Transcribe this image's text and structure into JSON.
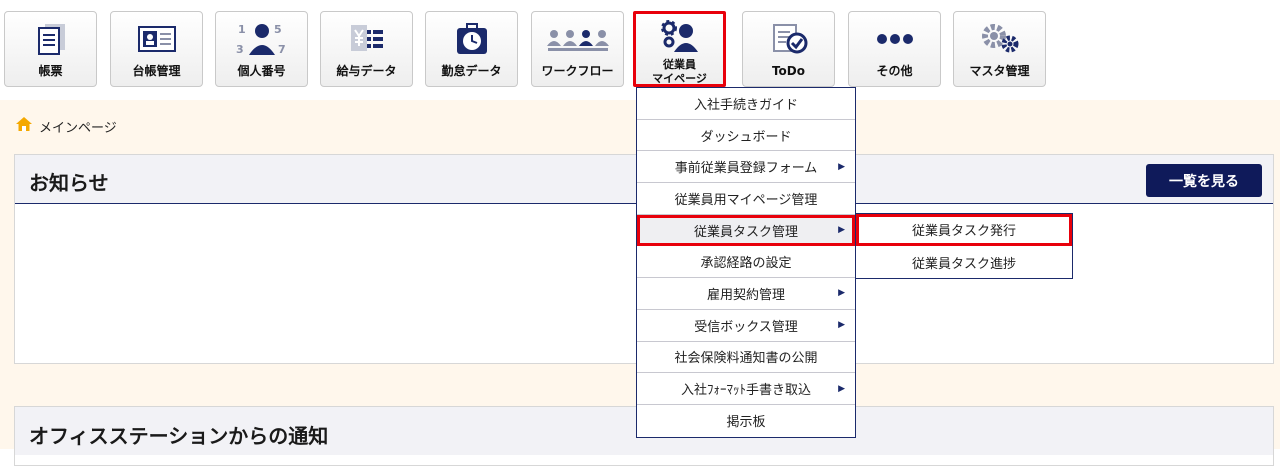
{
  "toolbar": {
    "buttons": [
      {
        "label": "帳票"
      },
      {
        "label": "台帳管理"
      },
      {
        "label": "個人番号"
      },
      {
        "label": "給与データ"
      },
      {
        "label": "勤怠データ"
      },
      {
        "label": "ワークフロー"
      },
      {
        "label_line1": "従業員",
        "label_line2": "マイページ"
      },
      {
        "label": "ToDo"
      },
      {
        "label": "その他"
      },
      {
        "label": "マスタ管理"
      }
    ]
  },
  "breadcrumb": {
    "label": "メインページ"
  },
  "notices": {
    "title": "お知らせ",
    "view_all_label": "一覧を見る"
  },
  "office_station": {
    "title": "オフィスステーションからの通知"
  },
  "menu": {
    "items": [
      {
        "label": "入社手続きガイド"
      },
      {
        "label": "ダッシュボード"
      },
      {
        "label": "事前従業員登録フォーム"
      },
      {
        "label": "従業員用マイページ管理"
      },
      {
        "label": "従業員タスク管理"
      },
      {
        "label": "承認経路の設定"
      },
      {
        "label": "雇用契約管理"
      },
      {
        "label": "受信ボックス管理"
      },
      {
        "label": "社会保険料通知書の公開"
      },
      {
        "label": "入社ﾌｫｰﾏｯﾄ手書き取込"
      },
      {
        "label": "掲示板"
      }
    ]
  },
  "submenu": {
    "items": [
      {
        "label": "従業員タスク発行"
      },
      {
        "label": "従業員タスク進捗"
      }
    ]
  },
  "icon_numbers": [
    "1",
    "5",
    "3",
    "7"
  ],
  "colors": {
    "accent": "#e8000b",
    "navy": "#0f1a5a",
    "content_bg": "#fff7ec",
    "icon_navy": "#1b2a6b"
  }
}
